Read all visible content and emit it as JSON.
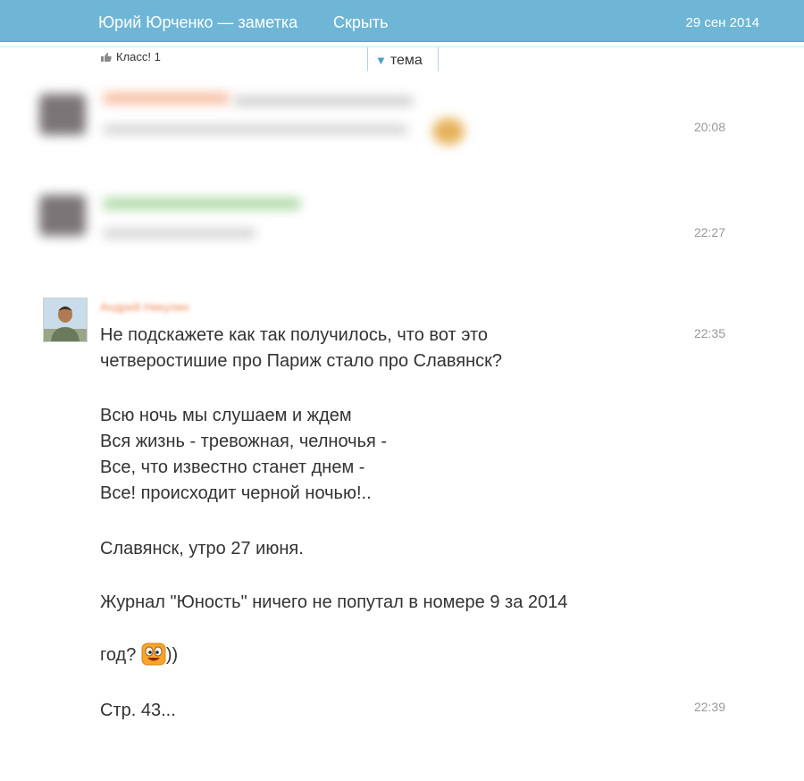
{
  "header": {
    "title": "Юрий Юрченко — заметка",
    "hide_label": "Скрыть",
    "date": "29 сен 2014"
  },
  "subbar": {
    "klass_label": "Класс! 1",
    "tab_label": "тема"
  },
  "messages": [
    {
      "time": "20:08",
      "blurred": true
    },
    {
      "time": "22:27",
      "blurred": true
    },
    {
      "time": "22:35",
      "author": "Андрей Никулин",
      "para1": "Не подскажете как так получилось, что вот это\nчетверостишие про Париж стало про Славянск?",
      "para2": "Всю ночь мы слушаем и ждем\nВся жизнь - тревожная, челночья -\nВсе, что известно станет днем -\nВсе! происходит черной ночью!..",
      "para3": "Славянск, утро 27 июня.",
      "para4_line1": "Журнал \"Юность\" ничего не попутал в номере 9 за 2014",
      "para4_line2_pre": "год? ",
      "para4_line2_post": "))",
      "smiley_icon": "laughing-smiley-icon"
    },
    {
      "time": "22:39",
      "text": "Стр. 43..."
    }
  ],
  "colors": {
    "header_bg": "#6fb6d6",
    "author_name": "#f08a55",
    "accent": "#4f9cc9"
  }
}
